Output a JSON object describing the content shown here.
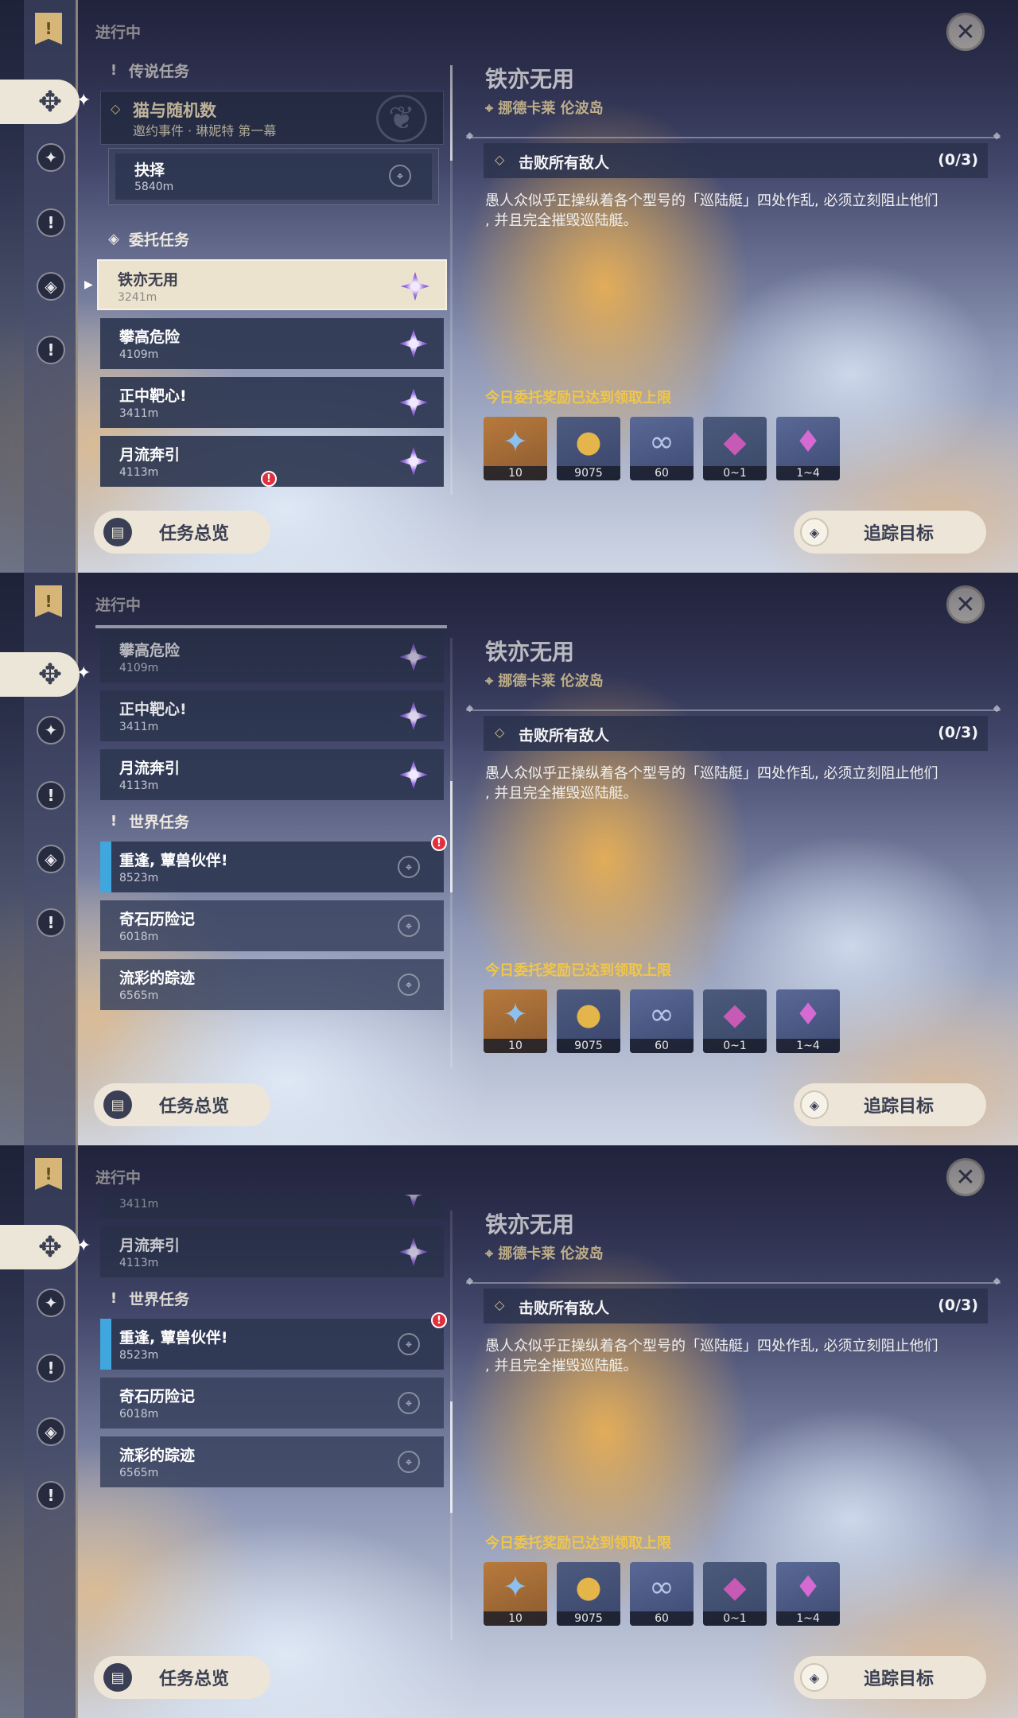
{
  "header": {
    "status": "进行中"
  },
  "sections": {
    "legend": "传说任务",
    "commission": "委托任务",
    "world": "世界任务"
  },
  "legend_quest": {
    "name": "猫与随机数",
    "subtitle": "邀约事件 · 琳妮特 第一幕",
    "step_name": "抉择",
    "step_dist": "5840m"
  },
  "commissions": [
    {
      "name": "铁亦无用",
      "dist": "3241m"
    },
    {
      "name": "攀高危险",
      "dist": "4109m"
    },
    {
      "name": "正中靶心!",
      "dist": "3411m"
    },
    {
      "name": "月流奔引",
      "dist": "4113m"
    }
  ],
  "world_quests": [
    {
      "name": "重逢, 蕈兽伙伴!",
      "dist": "8523m"
    },
    {
      "name": "奇石历险记",
      "dist": "6018m"
    },
    {
      "name": "流彩的踪迹",
      "dist": "6565m"
    }
  ],
  "detail": {
    "title": "铁亦无用",
    "location": "挪德卡莱 伦波岛",
    "objective": "击败所有敌人",
    "objective_count": "(0/3)",
    "description_line1": "愚人众似乎正操纵着各个型号的「巡陆艇」四处作乱, 必须立刻阻止他们",
    "description_line2": ", 并且完全摧毁巡陆艇。",
    "reward_note": "今日委托奖励已达到领取上限",
    "rewards": [
      {
        "icon": "primogem-icon",
        "count": "10"
      },
      {
        "icon": "mora-icon",
        "count": "9075"
      },
      {
        "icon": "companionship-exp-icon",
        "count": "60"
      },
      {
        "icon": "ore-crystal-icon",
        "count": "0~1"
      },
      {
        "icon": "crystal-cluster-icon",
        "count": "1~4"
      }
    ]
  },
  "buttons": {
    "overview": "任务总览",
    "track": "追踪目标"
  },
  "colors": {
    "reward_note": "#f0c64a",
    "location": "#e8d39f",
    "selected_card": "#ece3cf",
    "world_bar": "#3fa6de"
  }
}
